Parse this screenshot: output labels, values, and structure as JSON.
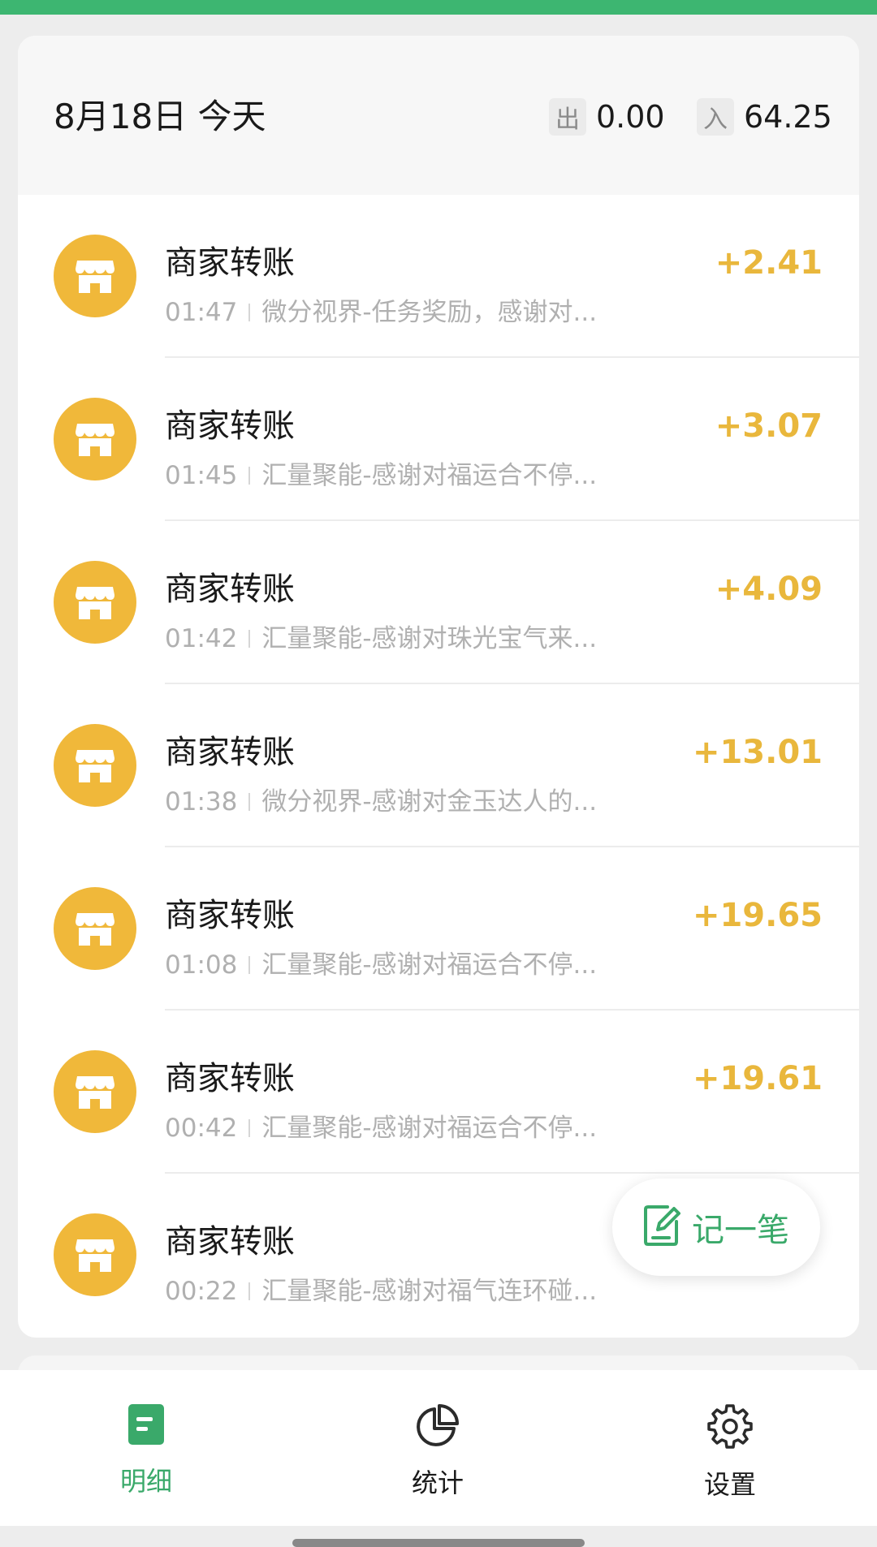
{
  "colors": {
    "top_bar": "#3db671",
    "accent_green": "#3aa96a",
    "income_yellow": "#e9b73c",
    "avatar_yellow": "#f0b83a"
  },
  "header": {
    "date": "8月18日 今天",
    "out_tag": "出",
    "out_amount": "0.00",
    "in_tag": "入",
    "in_amount": "64.25"
  },
  "transactions": [
    {
      "title": "商家转账",
      "time": "01:47",
      "desc": "微分视界-任务奖励，感谢对...",
      "amount": "+2.41",
      "icon": "shop-icon"
    },
    {
      "title": "商家转账",
      "time": "01:45",
      "desc": "汇量聚能-感谢对福运合不停...",
      "amount": "+3.07",
      "icon": "shop-icon"
    },
    {
      "title": "商家转账",
      "time": "01:42",
      "desc": "汇量聚能-感谢对珠光宝气来...",
      "amount": "+4.09",
      "icon": "shop-icon"
    },
    {
      "title": "商家转账",
      "time": "01:38",
      "desc": "微分视界-感谢对金玉达人的...",
      "amount": "+13.01",
      "icon": "shop-icon"
    },
    {
      "title": "商家转账",
      "time": "01:08",
      "desc": "汇量聚能-感谢对福运合不停...",
      "amount": "+19.65",
      "icon": "shop-icon"
    },
    {
      "title": "商家转账",
      "time": "00:42",
      "desc": "汇量聚能-感谢对福运合不停...",
      "amount": "+19.61",
      "icon": "shop-icon"
    },
    {
      "title": "商家转账",
      "time": "00:22",
      "desc": "汇量聚能-感谢对福气连环碰...",
      "amount": "",
      "icon": "shop-icon"
    }
  ],
  "fab": {
    "label": "记一笔",
    "icon": "edit-note-icon"
  },
  "nav": [
    {
      "label": "明细",
      "icon": "document-icon",
      "active": true
    },
    {
      "label": "统计",
      "icon": "pie-chart-icon",
      "active": false
    },
    {
      "label": "设置",
      "icon": "gear-icon",
      "active": false
    }
  ]
}
